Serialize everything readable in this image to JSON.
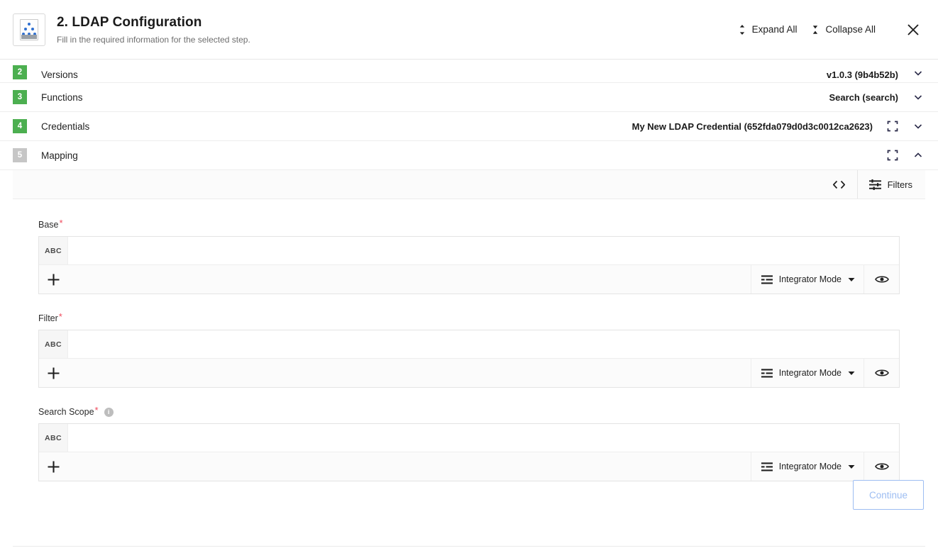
{
  "header": {
    "title": "2. LDAP Configuration",
    "subtitle": "Fill in the required information for the selected step.",
    "icon": "ldap-directory-icon",
    "expand_all_label": "Expand All",
    "collapse_all_label": "Collapse All",
    "expand_all_icon": "unfold-vertical-icon",
    "collapse_all_icon": "fold-vertical-icon",
    "close_icon": "close-icon"
  },
  "accordion": {
    "rows": [
      {
        "step": "2",
        "label": "Versions",
        "value": "v1.0.3 (9b4b52b)",
        "state": "complete",
        "expanded": false,
        "has_fullscreen": false,
        "chevron": "chevron-down-icon"
      },
      {
        "step": "3",
        "label": "Functions",
        "value": "Search (search)",
        "state": "complete",
        "expanded": false,
        "has_fullscreen": false,
        "chevron": "chevron-down-icon"
      },
      {
        "step": "4",
        "label": "Credentials",
        "value": "My New LDAP Credential (652fda079d0d3c0012ca2623)",
        "state": "complete",
        "expanded": false,
        "has_fullscreen": true,
        "chevron": "chevron-down-icon"
      },
      {
        "step": "5",
        "label": "Mapping",
        "value": "",
        "state": "current",
        "expanded": true,
        "has_fullscreen": true,
        "chevron": "chevron-up-icon"
      }
    ]
  },
  "toolbar": {
    "code_icon": "code-brackets-icon",
    "filters_icon": "sliders-icon",
    "filters_label": "Filters"
  },
  "fields": [
    {
      "label": "Base",
      "required": true,
      "has_info": false,
      "type_chip": "ABC",
      "value": "",
      "placeholder": "",
      "add_icon": "plus-icon",
      "mode_icon": "mode-lines-icon",
      "mode_label": "Integrator Mode",
      "mode_caret": "caret-down-icon",
      "preview_icon": "eye-icon"
    },
    {
      "label": "Filter",
      "required": true,
      "has_info": false,
      "type_chip": "ABC",
      "value": "",
      "placeholder": "",
      "add_icon": "plus-icon",
      "mode_icon": "mode-lines-icon",
      "mode_label": "Integrator Mode",
      "mode_caret": "caret-down-icon",
      "preview_icon": "eye-icon"
    },
    {
      "label": "Search Scope",
      "required": true,
      "has_info": true,
      "info_icon": "info-icon",
      "type_chip": "ABC",
      "value": "",
      "placeholder": "",
      "add_icon": "plus-icon",
      "mode_icon": "mode-lines-icon",
      "mode_label": "Integrator Mode",
      "mode_caret": "caret-down-icon",
      "preview_icon": "eye-icon"
    }
  ],
  "footer": {
    "continue_label": "Continue",
    "continue_disabled": true
  },
  "colors": {
    "badge_complete": "#4caf50",
    "badge_current": "#c6c6c6",
    "required_star": "#f04a5c",
    "continue_border": "#9dbdf2",
    "accent_link": "#2f6fd0"
  }
}
